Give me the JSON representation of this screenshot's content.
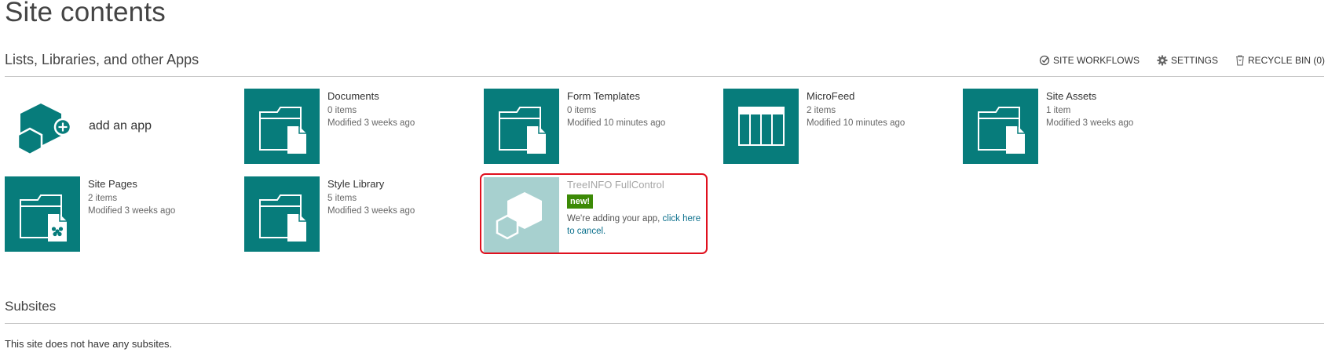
{
  "page": {
    "title": "Site contents"
  },
  "apps_section": {
    "title": "Lists, Libraries, and other Apps"
  },
  "toolbar": {
    "site_workflows": "SITE WORKFLOWS",
    "settings": "SETTINGS",
    "recycle_bin": "RECYCLE BIN (0)"
  },
  "add_app": {
    "label": "add an app"
  },
  "tiles": [
    {
      "name": "Documents",
      "count": "0 items",
      "modified": "Modified 3 weeks ago",
      "icon": "folder-document-icon"
    },
    {
      "name": "Form Templates",
      "count": "0 items",
      "modified": "Modified 10 minutes ago",
      "icon": "folder-document-icon"
    },
    {
      "name": "MicroFeed",
      "count": "2 items",
      "modified": "Modified 10 minutes ago",
      "icon": "list-table-icon"
    },
    {
      "name": "Site Assets",
      "count": "1 item",
      "modified": "Modified 3 weeks ago",
      "icon": "folder-document-icon"
    },
    {
      "name": "Site Pages",
      "count": "2 items",
      "modified": "Modified 3 weeks ago",
      "icon": "folder-page-icon"
    },
    {
      "name": "Style Library",
      "count": "5 items",
      "modified": "Modified 3 weeks ago",
      "icon": "folder-document-icon"
    }
  ],
  "pending_app": {
    "name": "TreeINFO FullControl",
    "badge": "new!",
    "message": "We're adding your app, ",
    "cancel_link": "click here to cancel."
  },
  "subsites": {
    "title": "Subsites",
    "empty_message": "This site does not have any subsites."
  },
  "colors": {
    "tile": "#077c7b",
    "pending_tile": "#a7d0cf",
    "badge": "#3c8a06",
    "highlight_border": "#e0101e"
  }
}
